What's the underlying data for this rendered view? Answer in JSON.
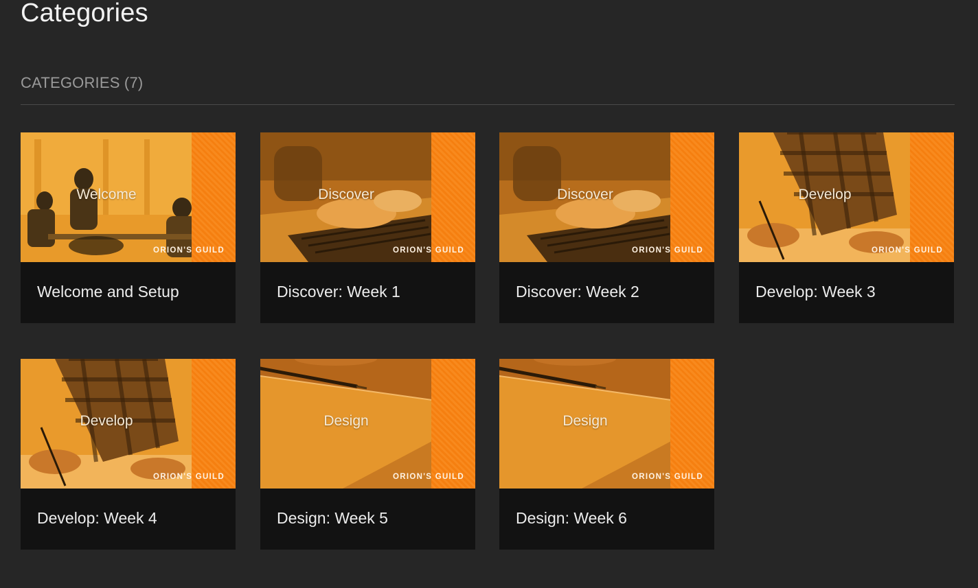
{
  "page": {
    "title": "Categories",
    "section_heading": "CATEGORIES (7)"
  },
  "colors": {
    "background": "#262626",
    "card_footer": "#121212",
    "accent_orange": "#f57f10"
  },
  "cards": [
    {
      "thumb_label": "Welcome",
      "brand": "ORION'S GUILD",
      "title": "Welcome and Setup",
      "scene": "meeting-room"
    },
    {
      "thumb_label": "Discover",
      "brand": "ORION'S GUILD",
      "title": "Discover: Week 1",
      "scene": "laptop-typing"
    },
    {
      "thumb_label": "Discover",
      "brand": "ORION'S GUILD",
      "title": "Discover: Week 2",
      "scene": "laptop-typing"
    },
    {
      "thumb_label": "Develop",
      "brand": "ORION'S GUILD",
      "title": "Develop: Week 3",
      "scene": "drafting"
    },
    {
      "thumb_label": "Develop",
      "brand": "ORION'S GUILD",
      "title": "Develop: Week 4",
      "scene": "drafting"
    },
    {
      "thumb_label": "Design",
      "brand": "ORION'S GUILD",
      "title": "Design: Week 5",
      "scene": "paper-pencil"
    },
    {
      "thumb_label": "Design",
      "brand": "ORION'S GUILD",
      "title": "Design: Week 6",
      "scene": "paper-pencil"
    }
  ]
}
